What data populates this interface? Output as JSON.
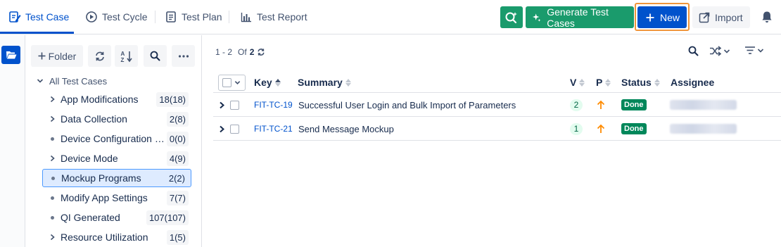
{
  "nav": {
    "tabs": [
      {
        "label": "Test Case",
        "icon": "edit-document-icon",
        "active": true
      },
      {
        "label": "Test Cycle",
        "icon": "play-circle-icon",
        "active": false
      },
      {
        "label": "Test Plan",
        "icon": "document-icon",
        "active": false
      },
      {
        "label": "Test Report",
        "icon": "bar-chart-icon",
        "active": false
      }
    ],
    "generate_label": "Generate Test Cases",
    "new_label": "New",
    "import_label": "Import"
  },
  "colors": {
    "primary": "#0052cc",
    "ai_green": "#1a9b6c",
    "highlight_ring": "#f0953a",
    "done_green": "#00875a",
    "priority_orange": "#ff8b00"
  },
  "folders": {
    "folder_button_label": "Folder",
    "root_label": "All Test Cases",
    "items": [
      {
        "name": "App Modifications",
        "count": "18(18)",
        "marker": "chevron"
      },
      {
        "name": "Data Collection",
        "count": "2(8)",
        "marker": "chevron"
      },
      {
        "name": "Device Configuration fo...",
        "count": "0(0)",
        "marker": "dot"
      },
      {
        "name": "Device Mode",
        "count": "4(9)",
        "marker": "chevron"
      },
      {
        "name": "Mockup Programs",
        "count": "2(2)",
        "marker": "dot",
        "selected": true
      },
      {
        "name": "Modify App Settings",
        "count": "7(7)",
        "marker": "dot"
      },
      {
        "name": "QI Generated",
        "count": "107(107)",
        "marker": "dot"
      },
      {
        "name": "Resource Utilization",
        "count": "1(5)",
        "marker": "chevron"
      }
    ]
  },
  "pager": {
    "range": "1 - 2",
    "of_label": "Of",
    "total": "2"
  },
  "table": {
    "headers": {
      "key": "Key",
      "summary": "Summary",
      "version": "V",
      "priority": "P",
      "status": "Status",
      "assignee": "Assignee"
    },
    "rows": [
      {
        "key": "FIT-TC-19",
        "summary": "Successful User Login and Bulk Import of Parameters",
        "version": "2",
        "priority": "high",
        "status": "Done"
      },
      {
        "key": "FIT-TC-21",
        "summary": "Send Message Mockup",
        "version": "1",
        "priority": "high",
        "status": "Done"
      }
    ]
  }
}
